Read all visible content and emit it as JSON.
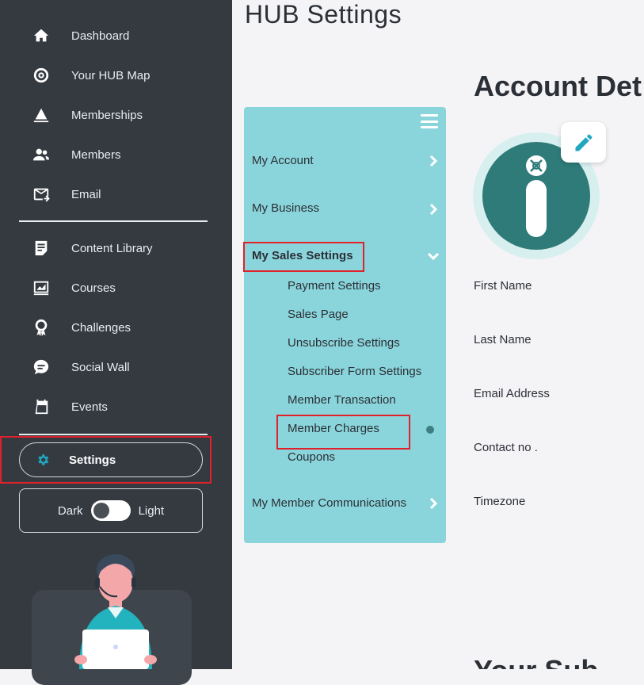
{
  "sidebar": {
    "items": [
      {
        "label": "Dashboard",
        "icon": "home-icon"
      },
      {
        "label": "Your HUB Map",
        "icon": "hub-map-icon"
      },
      {
        "label": "Memberships",
        "icon": "memberships-icon"
      },
      {
        "label": "Members",
        "icon": "members-icon"
      },
      {
        "label": "Email",
        "icon": "email-icon"
      },
      {
        "label": "Content Library",
        "icon": "content-library-icon"
      },
      {
        "label": "Courses",
        "icon": "courses-icon"
      },
      {
        "label": "Challenges",
        "icon": "challenges-icon"
      },
      {
        "label": "Social Wall",
        "icon": "chat-icon"
      },
      {
        "label": "Events",
        "icon": "events-icon"
      }
    ],
    "settings_label": "Settings",
    "theme": {
      "dark_label": "Dark",
      "light_label": "Light"
    }
  },
  "page": {
    "title": "HUB Settings"
  },
  "settings_menu": {
    "items": [
      {
        "label": "My Account"
      },
      {
        "label": "My Business"
      },
      {
        "label": "My Sales Settings"
      },
      {
        "label": "My Member Communications"
      }
    ],
    "sub_items": [
      {
        "label": "Payment Settings"
      },
      {
        "label": "Sales Page"
      },
      {
        "label": "Unsubscribe Settings"
      },
      {
        "label": "Subscriber Form Settings"
      },
      {
        "label": "Member Transaction"
      },
      {
        "label": "Member Charges"
      },
      {
        "label": "Coupons"
      }
    ]
  },
  "account": {
    "title": "Account Det",
    "fields": [
      {
        "label": "First Name"
      },
      {
        "label": "Last Name"
      },
      {
        "label": "Email Address"
      },
      {
        "label": "Contact no ."
      },
      {
        "label": "Timezone"
      }
    ],
    "next_heading": "Your Sub"
  },
  "colors": {
    "sidebar_bg": "#343a40",
    "panel_bg": "#8ad5db",
    "accent": "#1fa7c0",
    "avatar_bg": "#2e7b7a",
    "highlight": "#e0202a"
  }
}
